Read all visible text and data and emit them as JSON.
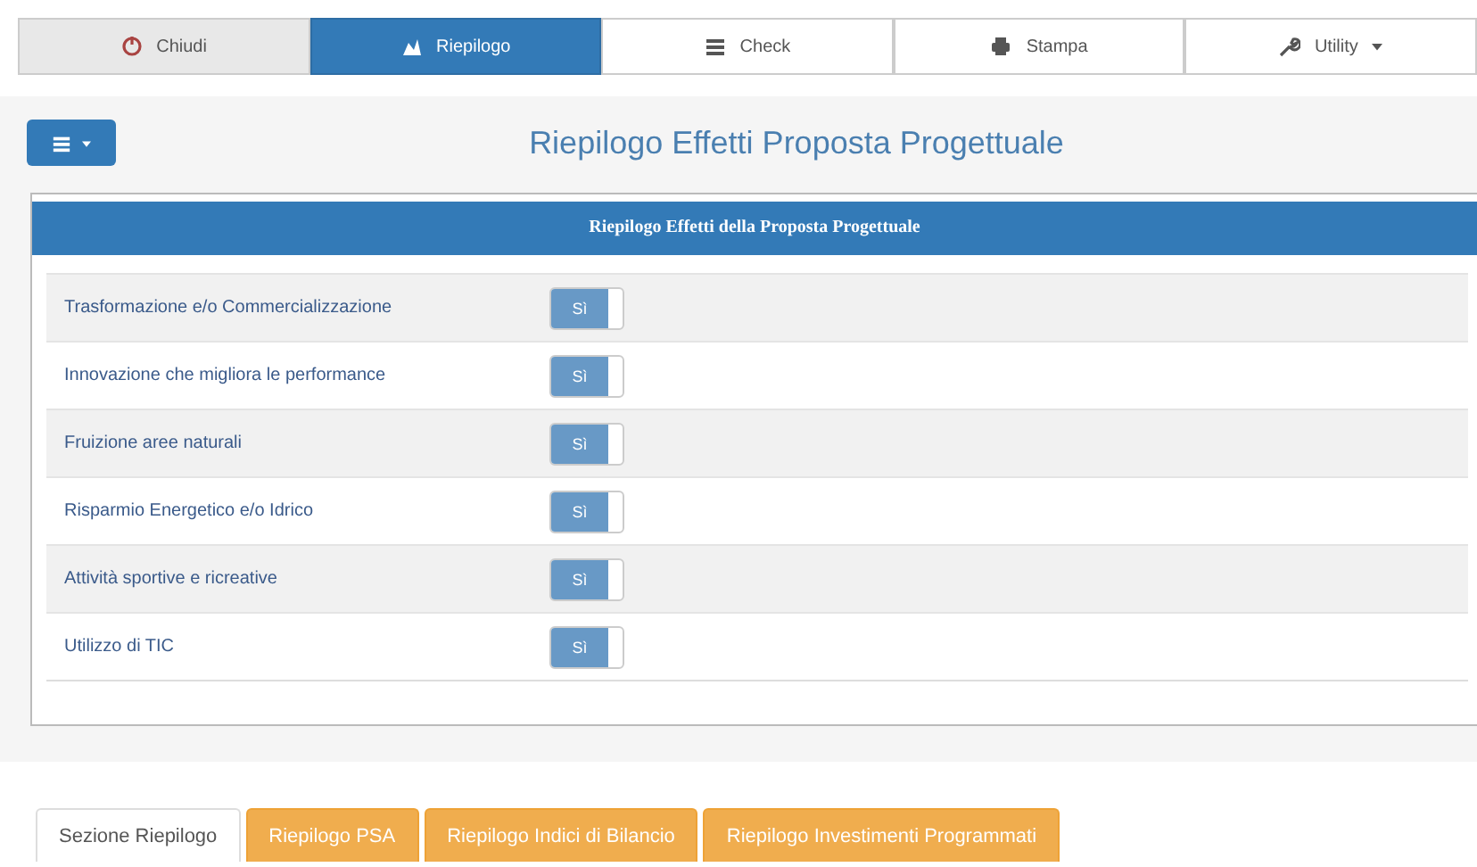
{
  "nav_tabs": [
    {
      "label": "Chiudi",
      "selected": false,
      "kind": "plain"
    },
    {
      "label": "Riepilogo",
      "selected": true,
      "kind": "plain"
    },
    {
      "label": "Check",
      "selected": false,
      "kind": "plain"
    },
    {
      "label": "Stampa",
      "selected": false,
      "kind": "plain"
    },
    {
      "label": "Utility",
      "selected": false,
      "kind": "dropdown"
    }
  ],
  "page_title": "Riepilogo Effetti Proposta Progettuale",
  "panel": {
    "title": "Riepilogo Effetti della Proposta Progettuale",
    "rows": [
      {
        "label": "Trasformazione e/o Commercializzazione",
        "toggle": "Sì",
        "on": true
      },
      {
        "label": "Innovazione che migliora le performance",
        "toggle": "Sì",
        "on": true
      },
      {
        "label": "Fruizione aree naturali",
        "toggle": "Sì",
        "on": true
      },
      {
        "label": "Risparmio Energetico e/o Idrico",
        "toggle": "Sì",
        "on": true
      },
      {
        "label": "Attività sportive e ricreative",
        "toggle": "Sì",
        "on": true
      },
      {
        "label": "Utilizzo di TIC",
        "toggle": "Sì",
        "on": true
      }
    ]
  },
  "bottom_tabs": [
    {
      "label": "Sezione Riepilogo",
      "selected": true
    },
    {
      "label": "Riepilogo PSA",
      "selected": false
    },
    {
      "label": "Riepilogo Indici di Bilancio",
      "selected": false
    },
    {
      "label": "Riepilogo Investimenti Programmati",
      "selected": false
    }
  ]
}
